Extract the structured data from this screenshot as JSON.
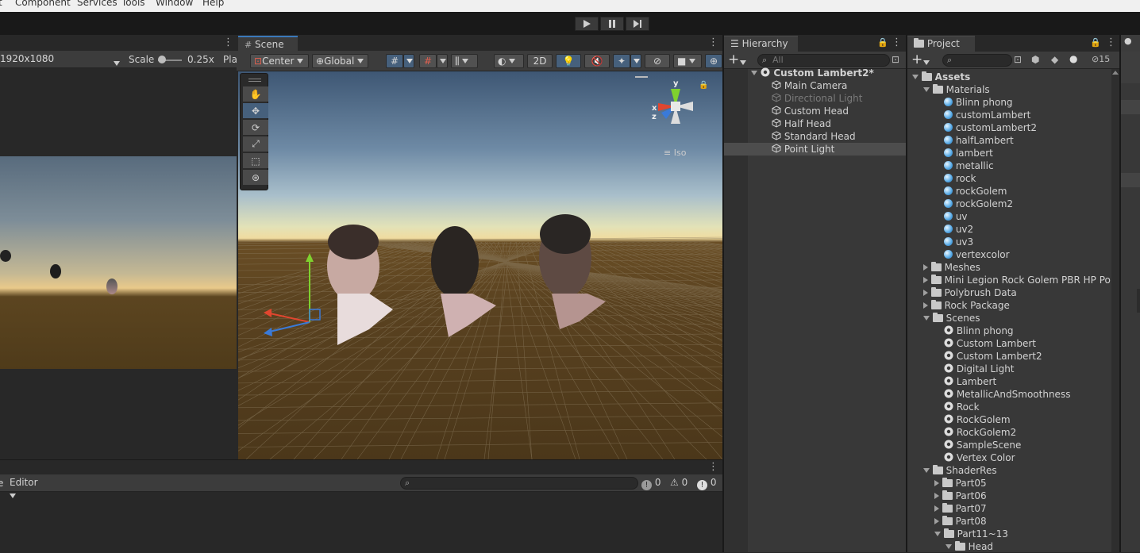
{
  "menubar": {
    "items": [
      "t",
      "Component",
      "Services",
      "Tools",
      "Window",
      "Help"
    ]
  },
  "game_view": {
    "resolution": "1920x1080",
    "scale_label": "Scale",
    "scale_value": "0.25x",
    "play_label": "Pla"
  },
  "scene": {
    "tab_label": "Scene",
    "pivot": "Center",
    "space": "Global",
    "mode_2d": "2D",
    "iso_label": "Iso",
    "gizmo_axes": [
      "y",
      "x",
      "z"
    ]
  },
  "hierarchy": {
    "tab_label": "Hierarchy",
    "search_placeholder": "All",
    "scene_name": "Custom Lambert2*",
    "items": [
      {
        "label": "Main Camera",
        "disabled": false
      },
      {
        "label": "Directional Light",
        "disabled": true
      },
      {
        "label": "Custom Head",
        "disabled": false
      },
      {
        "label": "Half Head",
        "disabled": false
      },
      {
        "label": "Standard Head",
        "disabled": false
      },
      {
        "label": "Point Light",
        "disabled": false,
        "selected": true
      }
    ]
  },
  "project": {
    "tab_label": "Project",
    "hidden_count": "15",
    "root": "Assets",
    "materials_folder": "Materials",
    "materials": [
      "Blinn phong",
      "customLambert",
      "customLambert2",
      "halfLambert",
      "lambert",
      "metallic",
      "rock",
      "rockGolem",
      "rockGolem2",
      "uv",
      "uv2",
      "uv3",
      "vertexcolor"
    ],
    "closed_folders": [
      "Meshes",
      "Mini Legion Rock Golem PBR HP Poly",
      "Polybrush Data",
      "Rock Package"
    ],
    "scenes_folder": "Scenes",
    "scenes": [
      "Blinn phong",
      "Custom Lambert",
      "Custom Lambert2",
      "Digital Light",
      "Lambert",
      "MetallicAndSmoothness",
      "Rock",
      "RockGolem",
      "RockGolem2",
      "SampleScene",
      "Vertex Color"
    ],
    "shaderres_folder": "ShaderRes",
    "shaderres_children": [
      "Part05",
      "Part06",
      "Part07",
      "Part08"
    ],
    "open_sub": "Part11~13",
    "head_folder": "Head"
  },
  "console": {
    "editor_label": "Editor",
    "log_count": "0",
    "warn_count": "0",
    "error_count": "0"
  },
  "colors": {
    "selection": "#46607c",
    "dark_bg": "#282828",
    "panel_bg": "#383838"
  }
}
